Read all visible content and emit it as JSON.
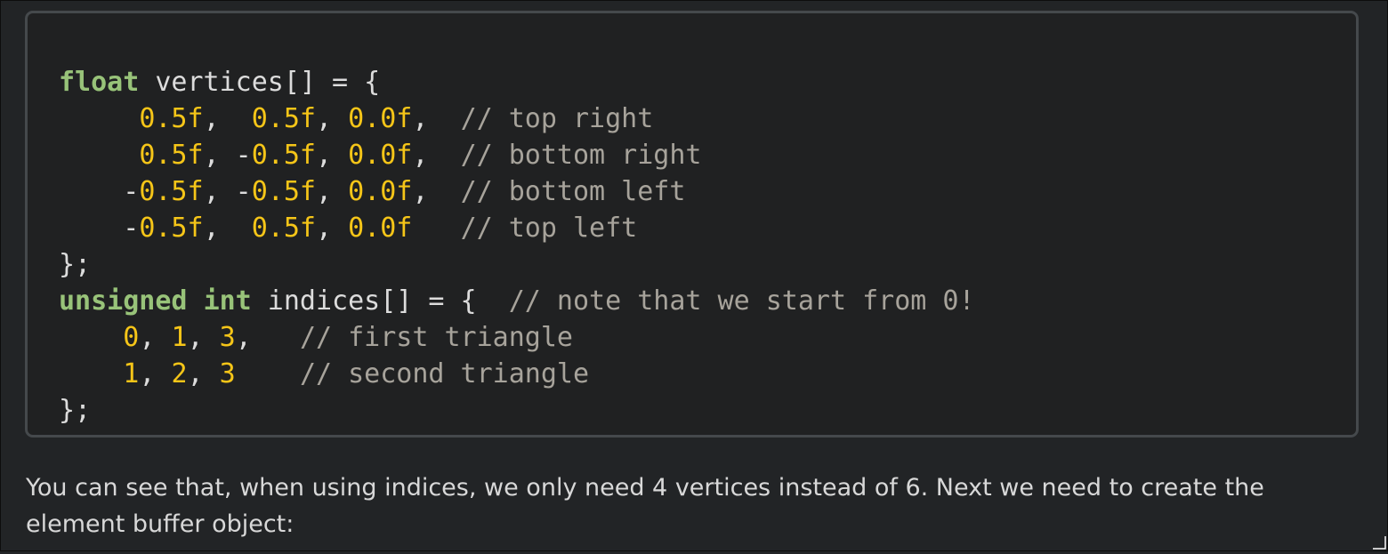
{
  "code_block": {
    "language": "cpp",
    "lines": [
      [
        {
          "t": "kw",
          "s": "float"
        },
        {
          "t": "pl",
          "s": " vertices[] = {"
        }
      ],
      [
        {
          "t": "pl",
          "s": "     "
        },
        {
          "t": "num",
          "s": "0.5f"
        },
        {
          "t": "pl",
          "s": ",  "
        },
        {
          "t": "num",
          "s": "0.5f"
        },
        {
          "t": "pl",
          "s": ", "
        },
        {
          "t": "num",
          "s": "0.0f"
        },
        {
          "t": "pl",
          "s": ",  "
        },
        {
          "t": "cm",
          "s": "// top right"
        }
      ],
      [
        {
          "t": "pl",
          "s": "     "
        },
        {
          "t": "num",
          "s": "0.5f"
        },
        {
          "t": "pl",
          "s": ", -"
        },
        {
          "t": "num",
          "s": "0.5f"
        },
        {
          "t": "pl",
          "s": ", "
        },
        {
          "t": "num",
          "s": "0.0f"
        },
        {
          "t": "pl",
          "s": ",  "
        },
        {
          "t": "cm",
          "s": "// bottom right"
        }
      ],
      [
        {
          "t": "pl",
          "s": "    -"
        },
        {
          "t": "num",
          "s": "0.5f"
        },
        {
          "t": "pl",
          "s": ", -"
        },
        {
          "t": "num",
          "s": "0.5f"
        },
        {
          "t": "pl",
          "s": ", "
        },
        {
          "t": "num",
          "s": "0.0f"
        },
        {
          "t": "pl",
          "s": ",  "
        },
        {
          "t": "cm",
          "s": "// bottom left"
        }
      ],
      [
        {
          "t": "pl",
          "s": "    -"
        },
        {
          "t": "num",
          "s": "0.5f"
        },
        {
          "t": "pl",
          "s": ",  "
        },
        {
          "t": "num",
          "s": "0.5f"
        },
        {
          "t": "pl",
          "s": ", "
        },
        {
          "t": "num",
          "s": "0.0f"
        },
        {
          "t": "pl",
          "s": "   "
        },
        {
          "t": "cm",
          "s": "// top left"
        }
      ],
      [
        {
          "t": "pl",
          "s": "};"
        }
      ],
      [
        {
          "t": "kw",
          "s": "unsigned"
        },
        {
          "t": "pl",
          "s": " "
        },
        {
          "t": "kw",
          "s": "int"
        },
        {
          "t": "pl",
          "s": " indices[] = {  "
        },
        {
          "t": "cm",
          "s": "// note that we start from 0!"
        }
      ],
      [
        {
          "t": "pl",
          "s": "    "
        },
        {
          "t": "num",
          "s": "0"
        },
        {
          "t": "pl",
          "s": ", "
        },
        {
          "t": "num",
          "s": "1"
        },
        {
          "t": "pl",
          "s": ", "
        },
        {
          "t": "num",
          "s": "3"
        },
        {
          "t": "pl",
          "s": ",   "
        },
        {
          "t": "cm",
          "s": "// first triangle"
        }
      ],
      [
        {
          "t": "pl",
          "s": "    "
        },
        {
          "t": "num",
          "s": "1"
        },
        {
          "t": "pl",
          "s": ", "
        },
        {
          "t": "num",
          "s": "2"
        },
        {
          "t": "pl",
          "s": ", "
        },
        {
          "t": "num",
          "s": "3"
        },
        {
          "t": "pl",
          "s": "    "
        },
        {
          "t": "cm",
          "s": "// second triangle"
        }
      ],
      [
        {
          "t": "pl",
          "s": "};"
        }
      ]
    ]
  },
  "paragraph": {
    "text": "You can see that, when using indices, we only need 4 vertices instead of 6. Next we need to create the element buffer object:"
  },
  "colors": {
    "background": "#222426",
    "code_background": "#202122",
    "code_border": "#45494c",
    "keyword": "#98c379",
    "number": "#f5c518",
    "comment": "#a7a39b",
    "plain": "#dcdcdc",
    "body_text": "#d8d8d8"
  },
  "icons": {
    "corner": "resize-grip-icon"
  }
}
